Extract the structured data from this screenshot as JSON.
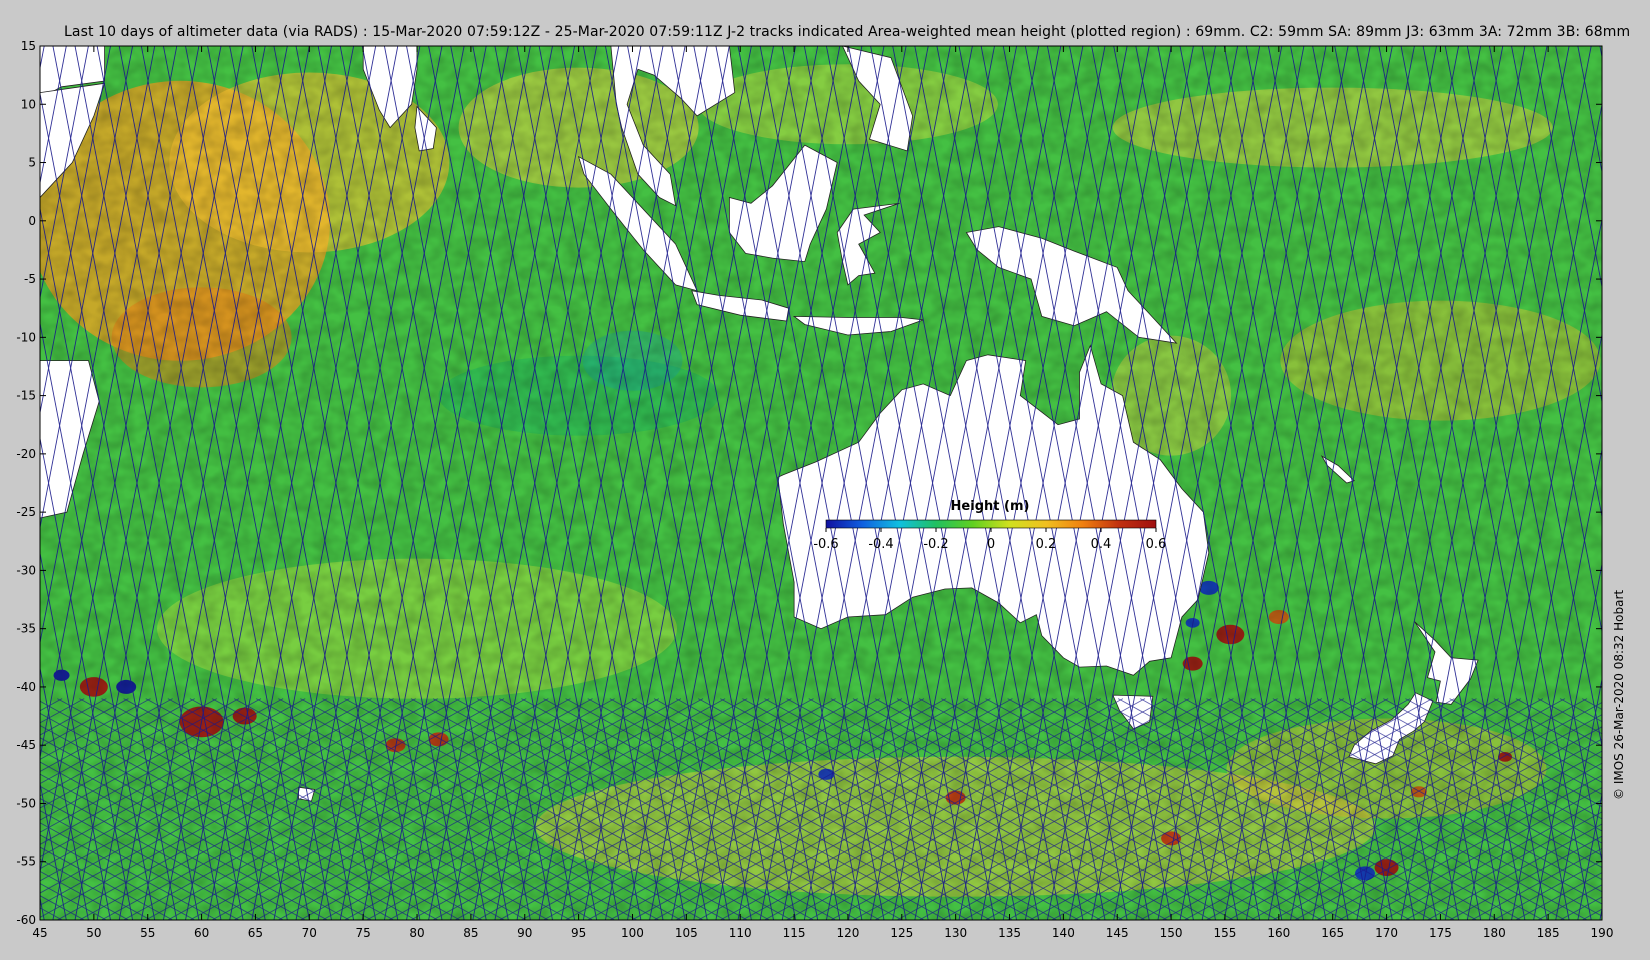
{
  "title": "Last 10 days of altimeter data (via RADS) : 15-Mar-2020 07:59:12Z - 25-Mar-2020 07:59:11Z  J-2 tracks indicated  Area-weighted mean height (plotted region) : 69mm.  C2: 59mm  SA: 89mm  J3: 63mm  3A: 72mm  3B: 68mm",
  "credit": "© IMOS 26-Mar-2020 08:32 Hobart",
  "colorbar": {
    "title": "Height (m)",
    "ticks": [
      "-0.6",
      "-0.4",
      "-0.2",
      "0",
      "0.2",
      "0.4",
      "0.6"
    ],
    "min": -0.6,
    "max": 0.6,
    "colors": [
      "#1010a0",
      "#1060e0",
      "#10c0e0",
      "#20c060",
      "#60d020",
      "#d0e020",
      "#f0c020",
      "#f08010",
      "#c03010",
      "#a01010"
    ]
  },
  "map": {
    "lon_range": [
      45,
      190
    ],
    "lat_range": [
      -60,
      15
    ],
    "x_ticks": [
      "45",
      "50",
      "55",
      "60",
      "65",
      "70",
      "75",
      "80",
      "85",
      "90",
      "95",
      "100",
      "105",
      "110",
      "115",
      "120",
      "125",
      "130",
      "135",
      "140",
      "145",
      "150",
      "155",
      "160",
      "165",
      "170",
      "175",
      "180",
      "185",
      "190"
    ],
    "y_ticks": [
      "15",
      "10",
      "5",
      "0",
      "-5",
      "-10",
      "-15",
      "-20",
      "-25",
      "-30",
      "-35",
      "-40",
      "-45",
      "-50",
      "-55",
      "-60"
    ],
    "track_color": "#1a1a8c",
    "land_color": "#ffffff"
  }
}
